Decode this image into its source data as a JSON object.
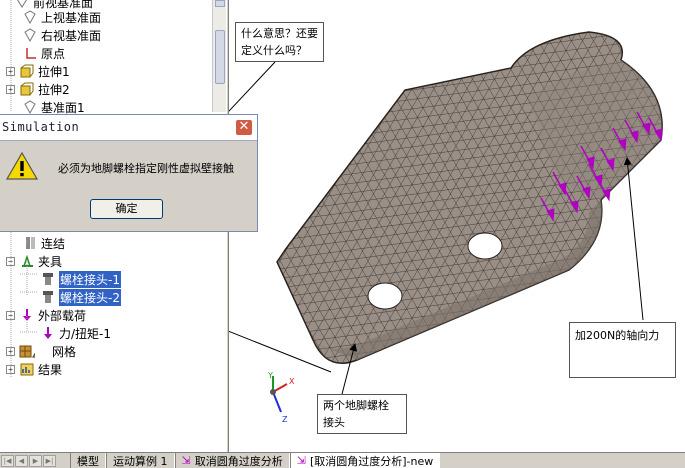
{
  "tree": {
    "items": [
      {
        "label": "前视基准面"
      },
      {
        "label": "上视基准面"
      },
      {
        "label": "右视基准面"
      },
      {
        "label": "原点"
      },
      {
        "label": "拉伸1"
      },
      {
        "label": "拉伸2"
      },
      {
        "label": "基准面1"
      },
      {
        "label": "连结"
      },
      {
        "label": "夹具"
      },
      {
        "label": "螺栓接头-1"
      },
      {
        "label": "螺栓接头-2"
      },
      {
        "label": "外部载荷"
      },
      {
        "label": "力/扭矩-1"
      },
      {
        "label": "网格"
      },
      {
        "label": "结果"
      }
    ]
  },
  "dialog": {
    "title": "Simulation",
    "message": "必须为地脚螺栓指定刚性虚拟壁接触",
    "ok_label": "确定"
  },
  "callouts": {
    "top": [
      "什么意思？还要",
      "定义什么吗？"
    ],
    "right": [
      "加200N的轴向力"
    ],
    "bottom": [
      "两个地脚螺栓",
      "接头"
    ]
  },
  "axes": {
    "x": "X",
    "y": "Y",
    "z": "Z"
  },
  "tabs": [
    {
      "label": "模型"
    },
    {
      "label": "运动算例 1"
    },
    {
      "label": "取消圆角过度分析"
    },
    {
      "label": "[取消圆角过度分析]-new"
    }
  ],
  "colors": {
    "mesh": "#9a8f86",
    "mesh_line": "#2a2320",
    "load": "#b000c0",
    "selection": "#3163c5",
    "dialog_bg": "#d4d0c8"
  }
}
